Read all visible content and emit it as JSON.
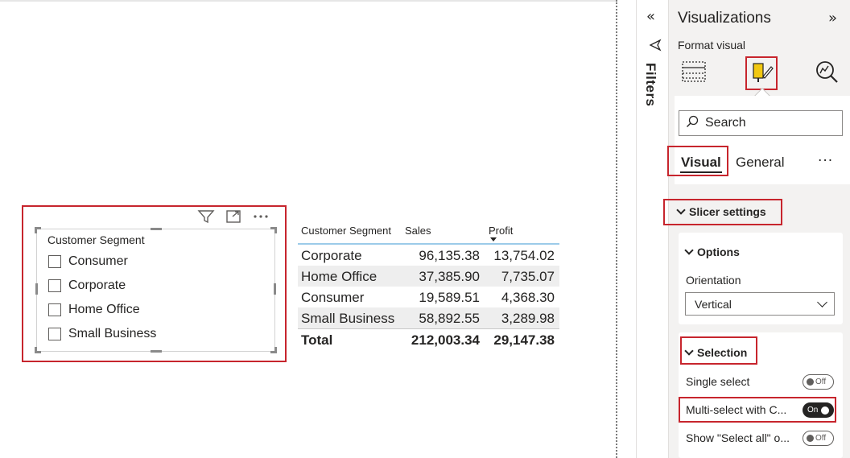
{
  "slicer": {
    "title": "Customer Segment",
    "items": [
      "Consumer",
      "Corporate",
      "Home Office",
      "Small Business"
    ],
    "header_icons": [
      "filter-icon",
      "focus-mode-icon",
      "more-options-icon"
    ]
  },
  "table": {
    "headers": [
      "Customer Segment",
      "Sales",
      "Profit"
    ],
    "rows": [
      {
        "segment": "Corporate",
        "sales": "96,135.38",
        "profit": "13,754.02"
      },
      {
        "segment": "Home Office",
        "sales": "37,385.90",
        "profit": "7,735.07"
      },
      {
        "segment": "Consumer",
        "sales": "19,589.51",
        "profit": "4,368.30"
      },
      {
        "segment": "Small Business",
        "sales": "58,892.55",
        "profit": "3,289.98"
      }
    ],
    "total": {
      "label": "Total",
      "sales": "212,003.34",
      "profit": "29,147.38"
    }
  },
  "filters": {
    "label": "Filters",
    "collapse_glyph": "«"
  },
  "viz": {
    "title": "Visualizations",
    "expand_glyph": "»",
    "subtitle": "Format visual",
    "search_placeholder": "Search",
    "tabs": [
      "Visual",
      "General"
    ],
    "more": "···",
    "section": "Slicer settings",
    "options": {
      "title": "Options",
      "orientation_label": "Orientation",
      "orientation_value": "Vertical"
    },
    "selection": {
      "title": "Selection",
      "rows": [
        {
          "label": "Single select",
          "state": "Off"
        },
        {
          "label": "Multi-select with C...",
          "state": "On"
        },
        {
          "label": "Show \"Select all\" o...",
          "state": "Off"
        }
      ]
    }
  },
  "colors": {
    "highlight": "#c7252d",
    "header_underline": "#9ccbe9",
    "pane_bg": "#f3f2f1"
  }
}
